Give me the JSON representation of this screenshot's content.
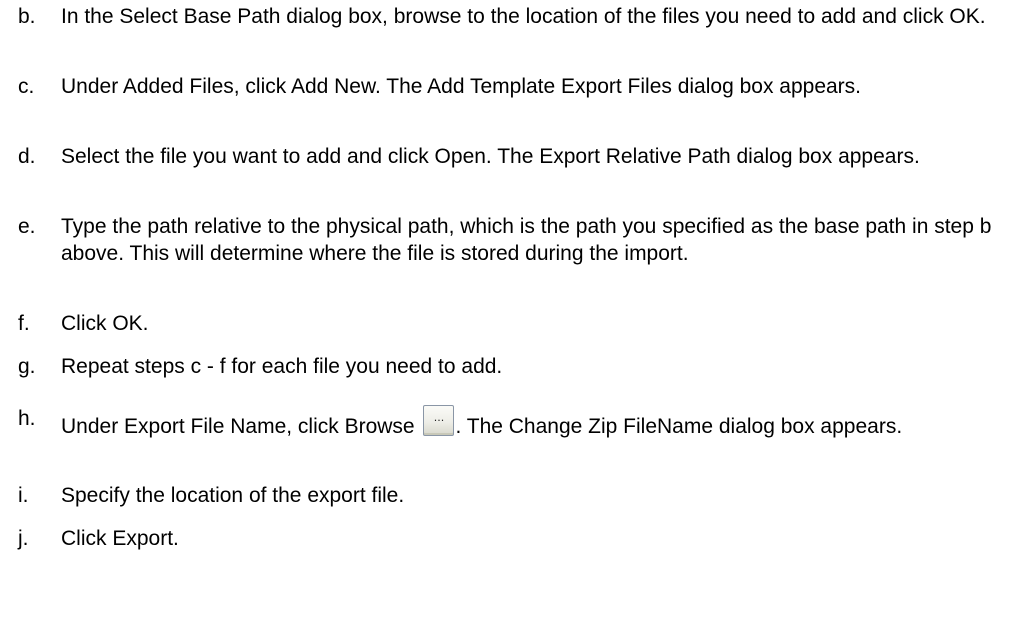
{
  "steps": [
    {
      "letter": "b.",
      "text": "In the Select Base Path dialog box, browse to the location of the files you need to add and click OK."
    },
    {
      "letter": "c.",
      "text": "Under Added Files, click Add New. The Add Template Export Files dialog box appears."
    },
    {
      "letter": "d.",
      "text": "Select the file you want to add and click Open. The Export Relative Path dialog box appears."
    },
    {
      "letter": "e.",
      "text": "Type the path relative to the physical path, which is the path you specified as the base path in step b above. This will determine where the file is stored during the import."
    },
    {
      "letter": "f.",
      "text": "Click OK."
    },
    {
      "letter": "g.",
      "text": "Repeat steps c - f for each file you need to add."
    },
    {
      "letter": "h.",
      "text_before": "Under Export File Name, click Browse",
      "button_label": "...",
      "button_icon": "ellipsis-browse-button-icon",
      "text_after": ". The Change Zip FileName dialog box appears."
    },
    {
      "letter": "i.",
      "text": "Specify the location of the export file."
    },
    {
      "letter": "j.",
      "text": "Click Export."
    }
  ]
}
